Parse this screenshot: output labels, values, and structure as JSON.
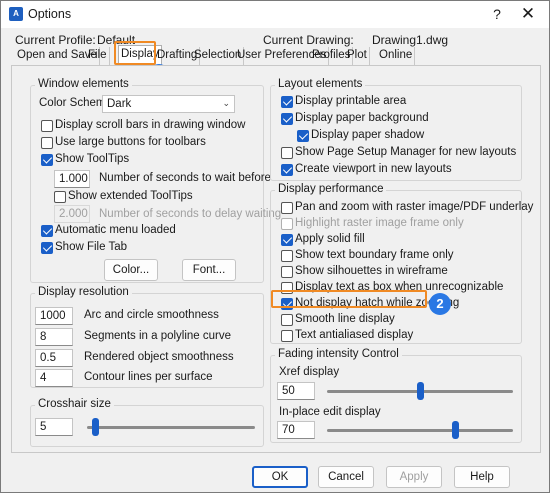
{
  "window": {
    "title": "Options",
    "help_glyph": "?",
    "close_glyph": "✕",
    "app_icon_text": "A"
  },
  "profile": {
    "current_profile_label": "Current Profile:",
    "current_profile_value": "Default",
    "current_drawing_label": "Current Drawing:",
    "current_drawing_value": "Drawing1.dwg"
  },
  "tabs": [
    "Open and Save",
    "File",
    "Display",
    "Drafting",
    "Selection",
    "User Preferences",
    "Profiles",
    "Plot",
    "Online"
  ],
  "active_tab": "Display",
  "badges": {
    "one": "1",
    "two": "2"
  },
  "window_elements": {
    "title": "Window elements",
    "color_scheme_label": "Color Scheme",
    "color_scheme_value": "Dark",
    "scroll_bars": "Display scroll bars in drawing window",
    "large_buttons": "Use large buttons for toolbars",
    "show_tooltips": "Show ToolTips",
    "tooltip_seconds_value": "1.000",
    "tooltip_seconds_label": "Number of seconds to wait before",
    "extended_tooltips": "Show extended ToolTips",
    "delay_seconds_value": "2.000",
    "delay_seconds_label": "Number of seconds to delay waiting",
    "auto_menu": "Automatic menu loaded",
    "show_file_tab": "Show File Tab",
    "color_button": "Color...",
    "font_button": "Font..."
  },
  "display_resolution": {
    "title": "Display resolution",
    "items": [
      {
        "value": "1000",
        "label": "Arc and circle smoothness"
      },
      {
        "value": "8",
        "label": "Segments in a polyline curve"
      },
      {
        "value": "0.5",
        "label": "Rendered object smoothness"
      },
      {
        "value": "4",
        "label": "Contour lines per surface"
      }
    ]
  },
  "crosshair": {
    "title": "Crosshair size",
    "value": "5",
    "slider_fraction": 0.05
  },
  "layout_elements": {
    "title": "Layout elements",
    "items": [
      {
        "label": "Display printable area",
        "checked": true
      },
      {
        "label": "Display paper background",
        "checked": true
      },
      {
        "label": "Display paper shadow",
        "checked": true
      },
      {
        "label": "Show Page Setup Manager for new layouts",
        "checked": false
      },
      {
        "label": "Create viewport in new layouts",
        "checked": true
      }
    ]
  },
  "display_performance": {
    "title": "Display performance",
    "items": [
      {
        "label": "Pan and zoom with raster image/PDF underlay",
        "checked": false
      },
      {
        "label": "Highlight raster image frame only",
        "checked": false,
        "disabled": true
      },
      {
        "label": "Apply solid fill",
        "checked": true
      },
      {
        "label": "Show text boundary frame only",
        "checked": false
      },
      {
        "label": "Show silhouettes in wireframe",
        "checked": false
      },
      {
        "label": "Display text as box when unrecognizable",
        "checked": false
      },
      {
        "label": "Not display hatch while zooming",
        "checked": true
      },
      {
        "label": "Smooth line display",
        "checked": false
      },
      {
        "label": "Text antialiased display",
        "checked": false
      }
    ]
  },
  "fading": {
    "title": "Fading intensity Control",
    "xref_label": "Xref display",
    "xref_value": "50",
    "xref_fraction": 0.5,
    "inplace_label": "In-place edit display",
    "inplace_value": "70",
    "inplace_fraction": 0.7
  },
  "footer": {
    "ok": "OK",
    "cancel": "Cancel",
    "apply": "Apply",
    "help": "Help"
  },
  "colors": {
    "accent": "#1a5fc8",
    "highlight": "#f08a24",
    "badge": "#2a78e4"
  }
}
